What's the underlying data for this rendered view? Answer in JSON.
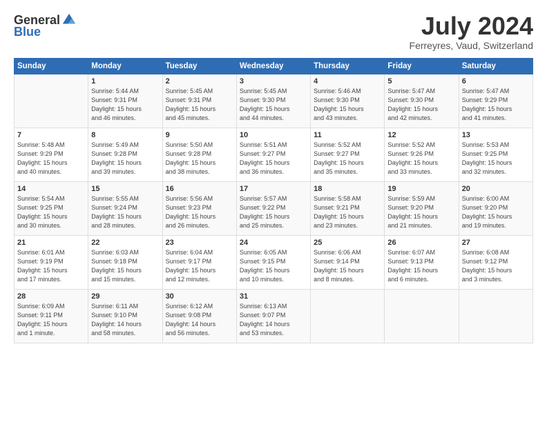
{
  "header": {
    "logo_general": "General",
    "logo_blue": "Blue",
    "month_title": "July 2024",
    "location": "Ferreyres, Vaud, Switzerland"
  },
  "days_of_week": [
    "Sunday",
    "Monday",
    "Tuesday",
    "Wednesday",
    "Thursday",
    "Friday",
    "Saturday"
  ],
  "weeks": [
    [
      {
        "day": "",
        "info": ""
      },
      {
        "day": "1",
        "info": "Sunrise: 5:44 AM\nSunset: 9:31 PM\nDaylight: 15 hours\nand 46 minutes."
      },
      {
        "day": "2",
        "info": "Sunrise: 5:45 AM\nSunset: 9:31 PM\nDaylight: 15 hours\nand 45 minutes."
      },
      {
        "day": "3",
        "info": "Sunrise: 5:45 AM\nSunset: 9:30 PM\nDaylight: 15 hours\nand 44 minutes."
      },
      {
        "day": "4",
        "info": "Sunrise: 5:46 AM\nSunset: 9:30 PM\nDaylight: 15 hours\nand 43 minutes."
      },
      {
        "day": "5",
        "info": "Sunrise: 5:47 AM\nSunset: 9:30 PM\nDaylight: 15 hours\nand 42 minutes."
      },
      {
        "day": "6",
        "info": "Sunrise: 5:47 AM\nSunset: 9:29 PM\nDaylight: 15 hours\nand 41 minutes."
      }
    ],
    [
      {
        "day": "7",
        "info": "Sunrise: 5:48 AM\nSunset: 9:29 PM\nDaylight: 15 hours\nand 40 minutes."
      },
      {
        "day": "8",
        "info": "Sunrise: 5:49 AM\nSunset: 9:28 PM\nDaylight: 15 hours\nand 39 minutes."
      },
      {
        "day": "9",
        "info": "Sunrise: 5:50 AM\nSunset: 9:28 PM\nDaylight: 15 hours\nand 38 minutes."
      },
      {
        "day": "10",
        "info": "Sunrise: 5:51 AM\nSunset: 9:27 PM\nDaylight: 15 hours\nand 36 minutes."
      },
      {
        "day": "11",
        "info": "Sunrise: 5:52 AM\nSunset: 9:27 PM\nDaylight: 15 hours\nand 35 minutes."
      },
      {
        "day": "12",
        "info": "Sunrise: 5:52 AM\nSunset: 9:26 PM\nDaylight: 15 hours\nand 33 minutes."
      },
      {
        "day": "13",
        "info": "Sunrise: 5:53 AM\nSunset: 9:25 PM\nDaylight: 15 hours\nand 32 minutes."
      }
    ],
    [
      {
        "day": "14",
        "info": "Sunrise: 5:54 AM\nSunset: 9:25 PM\nDaylight: 15 hours\nand 30 minutes."
      },
      {
        "day": "15",
        "info": "Sunrise: 5:55 AM\nSunset: 9:24 PM\nDaylight: 15 hours\nand 28 minutes."
      },
      {
        "day": "16",
        "info": "Sunrise: 5:56 AM\nSunset: 9:23 PM\nDaylight: 15 hours\nand 26 minutes."
      },
      {
        "day": "17",
        "info": "Sunrise: 5:57 AM\nSunset: 9:22 PM\nDaylight: 15 hours\nand 25 minutes."
      },
      {
        "day": "18",
        "info": "Sunrise: 5:58 AM\nSunset: 9:21 PM\nDaylight: 15 hours\nand 23 minutes."
      },
      {
        "day": "19",
        "info": "Sunrise: 5:59 AM\nSunset: 9:20 PM\nDaylight: 15 hours\nand 21 minutes."
      },
      {
        "day": "20",
        "info": "Sunrise: 6:00 AM\nSunset: 9:20 PM\nDaylight: 15 hours\nand 19 minutes."
      }
    ],
    [
      {
        "day": "21",
        "info": "Sunrise: 6:01 AM\nSunset: 9:19 PM\nDaylight: 15 hours\nand 17 minutes."
      },
      {
        "day": "22",
        "info": "Sunrise: 6:03 AM\nSunset: 9:18 PM\nDaylight: 15 hours\nand 15 minutes."
      },
      {
        "day": "23",
        "info": "Sunrise: 6:04 AM\nSunset: 9:17 PM\nDaylight: 15 hours\nand 12 minutes."
      },
      {
        "day": "24",
        "info": "Sunrise: 6:05 AM\nSunset: 9:15 PM\nDaylight: 15 hours\nand 10 minutes."
      },
      {
        "day": "25",
        "info": "Sunrise: 6:06 AM\nSunset: 9:14 PM\nDaylight: 15 hours\nand 8 minutes."
      },
      {
        "day": "26",
        "info": "Sunrise: 6:07 AM\nSunset: 9:13 PM\nDaylight: 15 hours\nand 6 minutes."
      },
      {
        "day": "27",
        "info": "Sunrise: 6:08 AM\nSunset: 9:12 PM\nDaylight: 15 hours\nand 3 minutes."
      }
    ],
    [
      {
        "day": "28",
        "info": "Sunrise: 6:09 AM\nSunset: 9:11 PM\nDaylight: 15 hours\nand 1 minute."
      },
      {
        "day": "29",
        "info": "Sunrise: 6:11 AM\nSunset: 9:10 PM\nDaylight: 14 hours\nand 58 minutes."
      },
      {
        "day": "30",
        "info": "Sunrise: 6:12 AM\nSunset: 9:08 PM\nDaylight: 14 hours\nand 56 minutes."
      },
      {
        "day": "31",
        "info": "Sunrise: 6:13 AM\nSunset: 9:07 PM\nDaylight: 14 hours\nand 53 minutes."
      },
      {
        "day": "",
        "info": ""
      },
      {
        "day": "",
        "info": ""
      },
      {
        "day": "",
        "info": ""
      }
    ]
  ]
}
